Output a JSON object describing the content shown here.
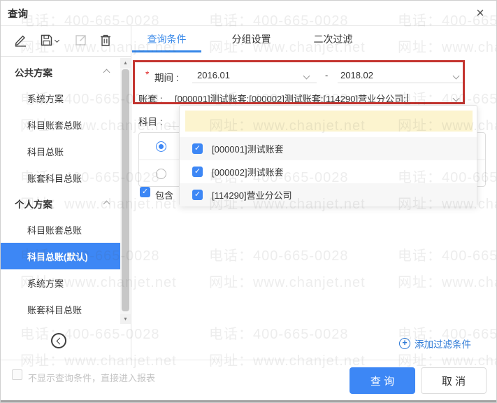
{
  "window": {
    "title": "查询"
  },
  "icons": {
    "close": "×",
    "check": "✓",
    "plus": "+",
    "scroll_up": "▲",
    "scroll_down": "▼"
  },
  "tabs": {
    "query": "查询条件",
    "grouping": "分组设置",
    "second_filter": "二次过滤"
  },
  "sidebar": {
    "public": {
      "header": "公共方案",
      "items": [
        "系统方案",
        "科目账套总账",
        "科目总账",
        "账套科目总账"
      ]
    },
    "personal": {
      "header": "个人方案",
      "items": [
        "科目账套总账",
        "科目总账(默认)",
        "系统方案",
        "账套科目总账"
      ],
      "selected": "科目总账(默认)"
    }
  },
  "form": {
    "period": {
      "required_mark": "*",
      "label": "期间 :",
      "from": "2016.01",
      "separator": "-",
      "to": "2018.02"
    },
    "account_set": {
      "label": "账套 :",
      "value": "[000001]测试账套;[000002]测试账套;[114290]营业分公司;"
    },
    "subject": {
      "label": "科目 :"
    },
    "include_label": "包含",
    "add_filter": "添加过滤条件"
  },
  "dropdown": {
    "options": [
      "[000001]测试账套",
      "[000002]测试账套",
      "[114290]营业分公司"
    ]
  },
  "footer": {
    "skip_label": "不显示查询条件，直接进入报表",
    "query": "查 询",
    "cancel": "取 消"
  },
  "watermark": {
    "line1": "电话：400-665-0028",
    "line2": "网址：www.chanjet.net"
  },
  "colors": {
    "accent": "#3d87f5",
    "tab_active": "#3687e8",
    "annotation_red": "#c4342f",
    "dropdown_highlight": "#fcf4cf",
    "selected_item_bg": "#3d87f5",
    "button_blue": "#3d87f5"
  }
}
